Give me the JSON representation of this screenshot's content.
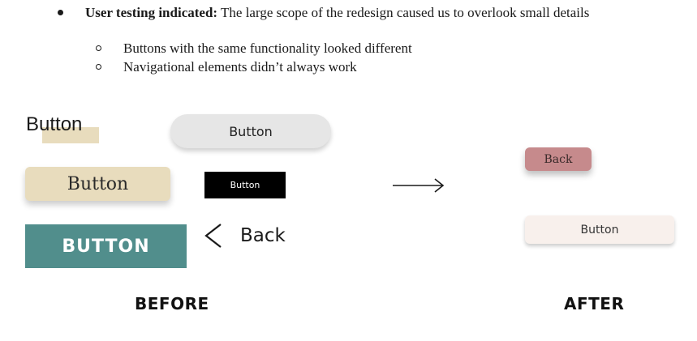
{
  "notes": {
    "bullet_bold": "User testing indicated:",
    "bullet_text": "The large scope of the redesign caused us to overlook small details",
    "sub_items": [
      "Buttons with the same functionality looked different",
      "Navigational elements didn’t always work"
    ]
  },
  "before": {
    "label": "BEFORE",
    "text_button": "Button",
    "pill_button": "Button",
    "beige_button": "Button",
    "black_button": "Button",
    "teal_button": "BUTTON",
    "back_link": "Back"
  },
  "after": {
    "label": "AFTER",
    "back_button": "Back",
    "button": "Button"
  },
  "colors": {
    "beige": "#e8dcbd",
    "teal": "#518e8c",
    "grey_pill": "#e6e6e6",
    "after_back": "#c68a8c",
    "after_button": "#f8f0ec"
  },
  "icons": [
    "chevron-left-icon",
    "right-arrow-icon"
  ]
}
